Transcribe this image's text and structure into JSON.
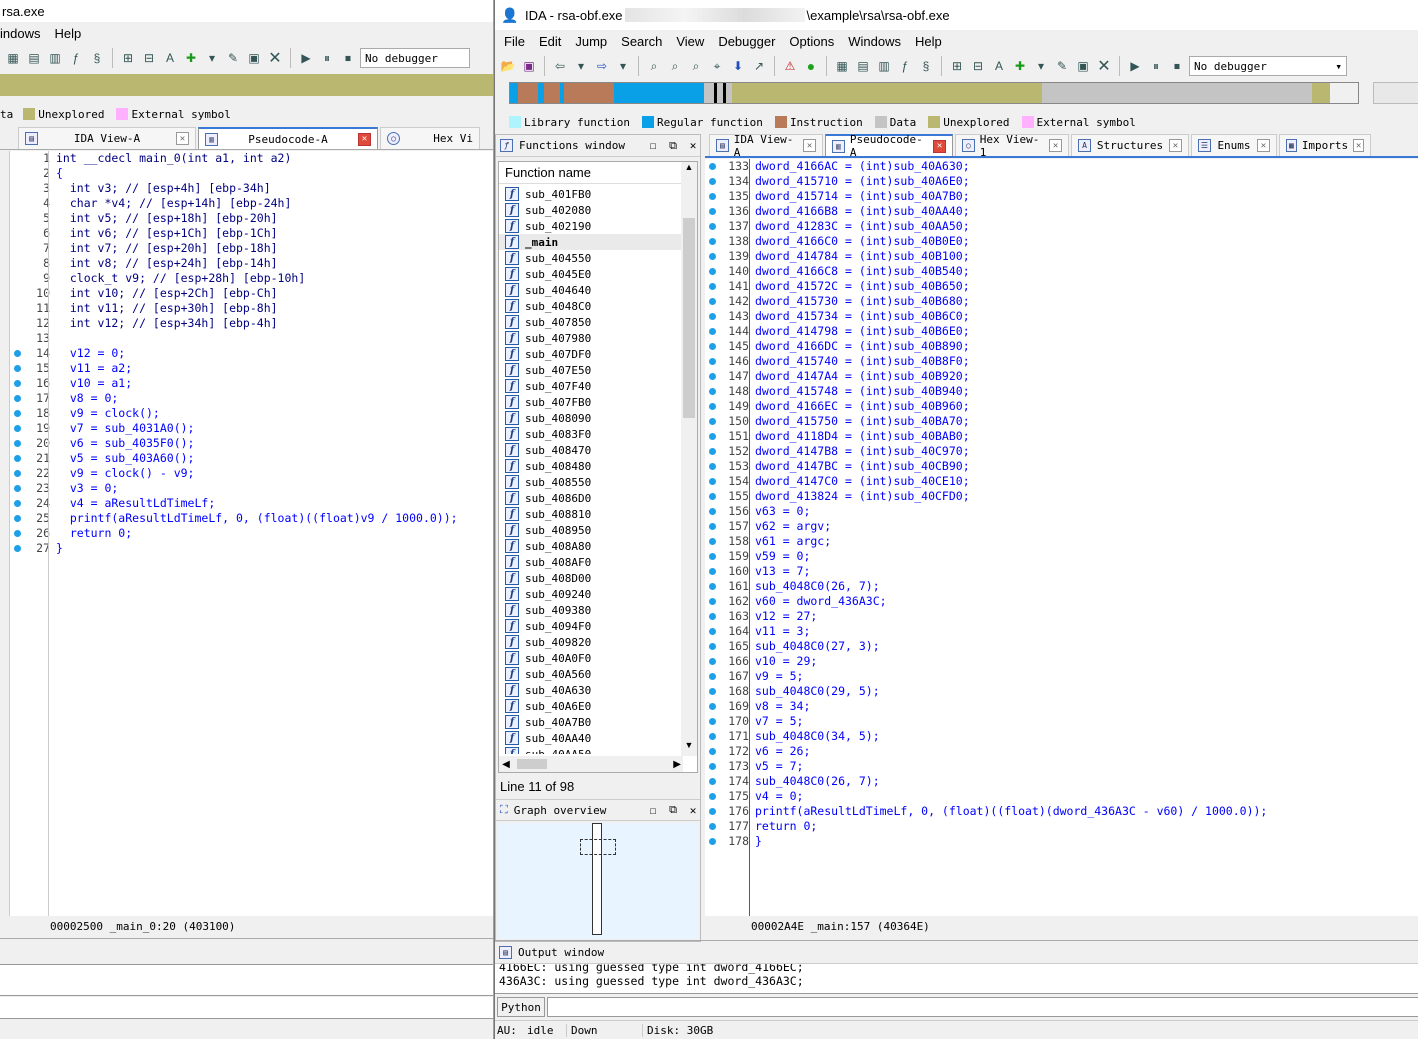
{
  "bg": {
    "title": "rsa.exe",
    "menu": [
      "indows",
      "Help"
    ],
    "debugger": "No debugger",
    "legend": [
      {
        "color": "#b9b770",
        "label": "Unexplored"
      },
      {
        "color": "#ffb0ff",
        "label": "External symbol"
      }
    ],
    "legend_prefix": "ta",
    "tabs": [
      {
        "label": "IDA View-A",
        "active": false
      },
      {
        "label": "Pseudocode-A",
        "active": true
      },
      {
        "label": "Hex Vi",
        "active": false
      }
    ],
    "code": [
      {
        "n": "1",
        "t": "int __cdecl main_0(int a1, int a2)",
        "d": false
      },
      {
        "n": "2",
        "t": "{",
        "d": false
      },
      {
        "n": "3",
        "t": "  int v3; // [esp+4h] [ebp-34h]",
        "d": false
      },
      {
        "n": "4",
        "t": "  char *v4; // [esp+14h] [ebp-24h]",
        "d": false
      },
      {
        "n": "5",
        "t": "  int v5; // [esp+18h] [ebp-20h]",
        "d": false
      },
      {
        "n": "6",
        "t": "  int v6; // [esp+1Ch] [ebp-1Ch]",
        "d": false
      },
      {
        "n": "7",
        "t": "  int v7; // [esp+20h] [ebp-18h]",
        "d": false
      },
      {
        "n": "8",
        "t": "  int v8; // [esp+24h] [ebp-14h]",
        "d": false
      },
      {
        "n": "9",
        "t": "  clock_t v9; // [esp+28h] [ebp-10h]",
        "d": false
      },
      {
        "n": "10",
        "t": "  int v10; // [esp+2Ch] [ebp-Ch]",
        "d": false
      },
      {
        "n": "11",
        "t": "  int v11; // [esp+30h] [ebp-8h]",
        "d": false
      },
      {
        "n": "12",
        "t": "  int v12; // [esp+34h] [ebp-4h]",
        "d": false
      },
      {
        "n": "13",
        "t": "",
        "d": false
      },
      {
        "n": "14",
        "t": "  v12 = 0;",
        "d": true
      },
      {
        "n": "15",
        "t": "  v11 = a2;",
        "d": true
      },
      {
        "n": "16",
        "t": "  v10 = a1;",
        "d": true
      },
      {
        "n": "17",
        "t": "  v8 = 0;",
        "d": true
      },
      {
        "n": "18",
        "t": "  v9 = clock();",
        "d": true
      },
      {
        "n": "19",
        "t": "  v7 = sub_4031A0();",
        "d": true
      },
      {
        "n": "20",
        "t": "  v6 = sub_4035F0();",
        "d": true
      },
      {
        "n": "21",
        "t": "  v5 = sub_403A60();",
        "d": true
      },
      {
        "n": "22",
        "t": "  v9 = clock() - v9;",
        "d": true
      },
      {
        "n": "23",
        "t": "  v3 = 0;",
        "d": true
      },
      {
        "n": "24",
        "t": "  v4 = aResultLdTimeLf;",
        "d": true
      },
      {
        "n": "25",
        "t": "  printf(aResultLdTimeLf, 0, (float)((float)v9 / 1000.0));",
        "d": true
      },
      {
        "n": "26",
        "t": "  return 0;",
        "d": true
      },
      {
        "n": "27",
        "t": "}",
        "d": true
      }
    ],
    "status": "00002500 _main_0:20 (403100)"
  },
  "fg": {
    "title_left": "IDA - rsa-obf.exe",
    "title_right": "\\example\\rsa\\rsa-obf.exe",
    "menu": [
      "File",
      "Edit",
      "Jump",
      "Search",
      "View",
      "Debugger",
      "Options",
      "Windows",
      "Help"
    ],
    "debugger": "No debugger",
    "legend": [
      {
        "color": "#aef4ff",
        "label": "Library function"
      },
      {
        "color": "#0aa0e8",
        "label": "Regular function"
      },
      {
        "color": "#b87a58",
        "label": "Instruction"
      },
      {
        "color": "#c4c4c4",
        "label": "Data"
      },
      {
        "color": "#b9b770",
        "label": "Unexplored"
      },
      {
        "color": "#ffb0ff",
        "label": "External symbol"
      }
    ],
    "functions_title": "Functions window",
    "functions_header": "Function name",
    "functions": [
      "sub_401FB0",
      "sub_402080",
      "sub_402190",
      "_main",
      "sub_404550",
      "sub_4045E0",
      "sub_404640",
      "sub_4048C0",
      "sub_407850",
      "sub_407980",
      "sub_407DF0",
      "sub_407E50",
      "sub_407F40",
      "sub_407FB0",
      "sub_408090",
      "sub_4083F0",
      "sub_408470",
      "sub_408480",
      "sub_408550",
      "sub_4086D0",
      "sub_408810",
      "sub_408950",
      "sub_408A80",
      "sub_408AF0",
      "sub_408D00",
      "sub_409240",
      "sub_409380",
      "sub_4094F0",
      "sub_409820",
      "sub_40A0F0",
      "sub_40A560",
      "sub_40A630",
      "sub_40A6E0",
      "sub_40A7B0",
      "sub_40AA40",
      "sub_40AA50"
    ],
    "selected_function": "_main",
    "line_info": "Line 11 of 98",
    "graph_title": "Graph overview",
    "tabs": [
      {
        "label": "IDA View-A",
        "active": false
      },
      {
        "label": "Pseudocode-A",
        "active": true
      },
      {
        "label": "Hex View-1",
        "active": false
      },
      {
        "label": "Structures",
        "active": false
      },
      {
        "label": "Enums",
        "active": false
      },
      {
        "label": "Imports",
        "active": false
      }
    ],
    "code": [
      {
        "n": "133",
        "t": "dword_4166AC = (int)sub_40A630;"
      },
      {
        "n": "134",
        "t": "dword_415710 = (int)sub_40A6E0;"
      },
      {
        "n": "135",
        "t": "dword_415714 = (int)sub_40A7B0;"
      },
      {
        "n": "136",
        "t": "dword_4166B8 = (int)sub_40AA40;"
      },
      {
        "n": "137",
        "t": "dword_41283C = (int)sub_40AA50;"
      },
      {
        "n": "138",
        "t": "dword_4166C0 = (int)sub_40B0E0;"
      },
      {
        "n": "139",
        "t": "dword_414784 = (int)sub_40B100;"
      },
      {
        "n": "140",
        "t": "dword_4166C8 = (int)sub_40B540;"
      },
      {
        "n": "141",
        "t": "dword_41572C = (int)sub_40B650;"
      },
      {
        "n": "142",
        "t": "dword_415730 = (int)sub_40B680;"
      },
      {
        "n": "143",
        "t": "dword_415734 = (int)sub_40B6C0;"
      },
      {
        "n": "144",
        "t": "dword_414798 = (int)sub_40B6E0;"
      },
      {
        "n": "145",
        "t": "dword_4166DC = (int)sub_40B890;"
      },
      {
        "n": "146",
        "t": "dword_415740 = (int)sub_40B8F0;"
      },
      {
        "n": "147",
        "t": "dword_4147A4 = (int)sub_40B920;"
      },
      {
        "n": "148",
        "t": "dword_415748 = (int)sub_40B940;"
      },
      {
        "n": "149",
        "t": "dword_4166EC = (int)sub_40B960;"
      },
      {
        "n": "150",
        "t": "dword_415750 = (int)sub_40BA70;"
      },
      {
        "n": "151",
        "t": "dword_4118D4 = (int)sub_40BAB0;"
      },
      {
        "n": "152",
        "t": "dword_4147B8 = (int)sub_40C970;"
      },
      {
        "n": "153",
        "t": "dword_4147BC = (int)sub_40CB90;"
      },
      {
        "n": "154",
        "t": "dword_4147C0 = (int)sub_40CE10;"
      },
      {
        "n": "155",
        "t": "dword_413824 = (int)sub_40CFD0;"
      },
      {
        "n": "156",
        "t": "v63 = 0;"
      },
      {
        "n": "157",
        "t": "v62 = argv;"
      },
      {
        "n": "158",
        "t": "v61 = argc;"
      },
      {
        "n": "159",
        "t": "v59 = 0;"
      },
      {
        "n": "160",
        "t": "v13 = 7;"
      },
      {
        "n": "161",
        "t": "sub_4048C0(26, 7);"
      },
      {
        "n": "162",
        "t": "v60 = dword_436A3C;"
      },
      {
        "n": "163",
        "t": "v12 = 27;"
      },
      {
        "n": "164",
        "t": "v11 = 3;"
      },
      {
        "n": "165",
        "t": "sub_4048C0(27, 3);"
      },
      {
        "n": "166",
        "t": "v10 = 29;"
      },
      {
        "n": "167",
        "t": "v9 = 5;"
      },
      {
        "n": "168",
        "t": "sub_4048C0(29, 5);"
      },
      {
        "n": "169",
        "t": "v8 = 34;"
      },
      {
        "n": "170",
        "t": "v7 = 5;"
      },
      {
        "n": "171",
        "t": "sub_4048C0(34, 5);"
      },
      {
        "n": "172",
        "t": "v6 = 26;"
      },
      {
        "n": "173",
        "t": "v5 = 7;"
      },
      {
        "n": "174",
        "t": "sub_4048C0(26, 7);"
      },
      {
        "n": "175",
        "t": "v4 = 0;"
      },
      {
        "n": "176",
        "t": "printf(aResultLdTimeLf, 0, (float)((float)(dword_436A3C - v60) / 1000.0));"
      },
      {
        "n": "177",
        "t": "return 0;"
      },
      {
        "n": "178",
        "t": "}"
      }
    ],
    "status": "00002A4E _main:157 (40364E)",
    "output_title": "Output window",
    "output_lines": [
      "4166EC: using guessed type int dword_4166EC;",
      "436A3C: using guessed type int dword_436A3C;"
    ],
    "python_label": "Python",
    "statusbar": {
      "au": "AU:",
      "state": "idle",
      "direction": "Down",
      "disk": "Disk: 30GB"
    }
  }
}
